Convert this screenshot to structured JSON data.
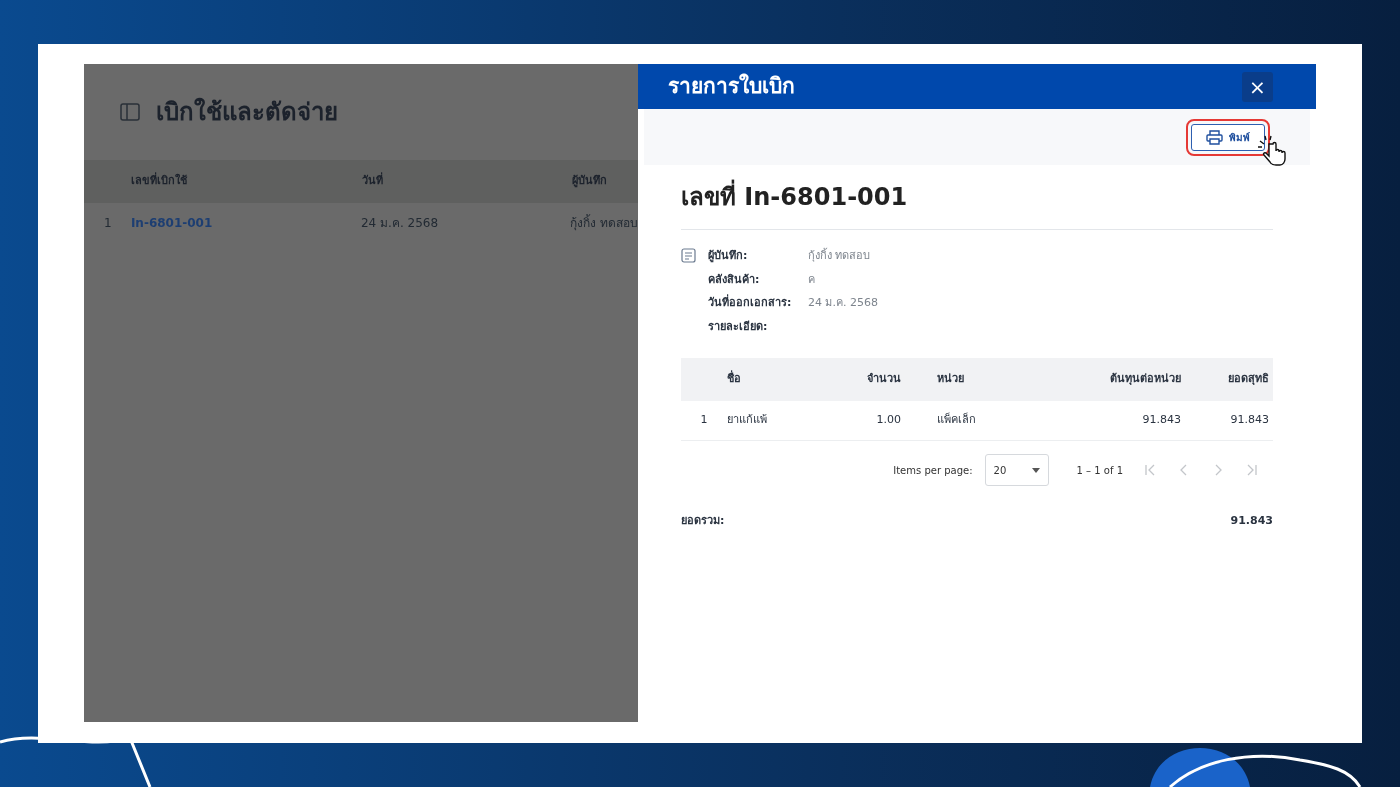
{
  "page": {
    "title": "เบิกใช้และตัดจ่าย",
    "columns": [
      "เลขที่เบิกใช้",
      "วันที่",
      "ผู้บันทึก"
    ],
    "rows": [
      {
        "index": "1",
        "number": "In-6801-001",
        "date": "24 ม.ค. 2568",
        "recorder": "กุ้งกิ้ง ทดสอบ"
      }
    ]
  },
  "drawer": {
    "title": "รายการใบเบิก",
    "close": "×",
    "print_button": "พิมพ์",
    "heading": "เลขที่ In-6801-001",
    "info": [
      {
        "label": "ผู้บันทึก:",
        "value": "กุ้งกิ้ง ทดสอบ"
      },
      {
        "label": "คลังสินค้า:",
        "value": "ค"
      },
      {
        "label": "วันที่ออกเอกสาร:",
        "value": "24 ม.ค. 2568"
      },
      {
        "label": "รายละเอียด:"
      }
    ],
    "table": {
      "columns": [
        "ชื่อ",
        "จำนวน",
        "หน่วย",
        "ต้นทุนต่อหน่วย",
        "ยอดสุทธิ"
      ],
      "rows": [
        {
          "index": "1",
          "name": "ยาแก้แพ้",
          "qty": "1.00",
          "unit": "แพ็คเล็ก",
          "cost": "91.843",
          "net": "91.843"
        }
      ]
    },
    "pagination": {
      "label": "Items per page:",
      "page_size": "20",
      "range": "1 – 1 of 1"
    },
    "total": {
      "label": "ยอดรวม:",
      "value": "91.843"
    }
  }
}
